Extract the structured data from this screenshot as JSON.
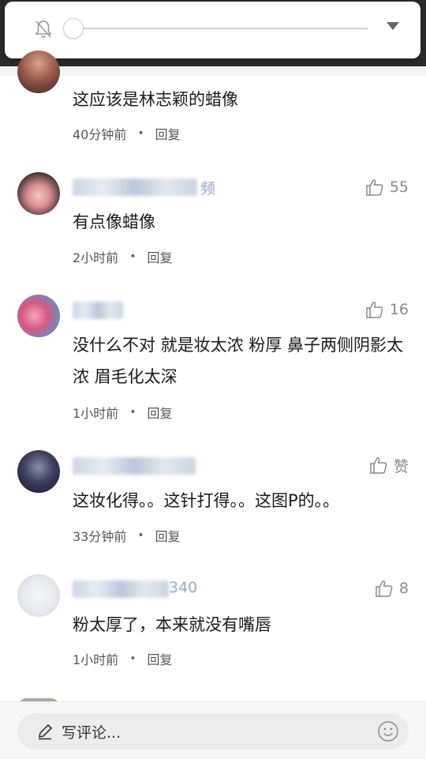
{
  "colors": {
    "accent_link": "#4a76b5",
    "text_primary": "#1a1a1a",
    "text_meta": "#555555"
  },
  "volume": {
    "level": 0.0
  },
  "comments": [
    {
      "username_tail": "",
      "text": "这应该是林志颖的蜡像",
      "time": "40分钟前",
      "reply": "回复",
      "likes": ""
    },
    {
      "username_tail": "频",
      "text": "有点像蜡像",
      "time": "2小时前",
      "reply": "回复",
      "likes": "55"
    },
    {
      "username_tail": "",
      "text": "没什么不对 就是妆太浓 粉厚 鼻子两侧阴影太浓 眉毛化太深",
      "time": "1小时前",
      "reply": "回复",
      "likes": "16"
    },
    {
      "username_tail": "",
      "text": "这妆化得。。这针打得。。这图P的。。",
      "time": "33分钟前",
      "reply": "回复",
      "likes": "赞"
    },
    {
      "username_tail": "340",
      "text": "粉太厚了，本来就没有嘴唇",
      "time": "1小时前",
      "reply": "回复",
      "likes": "8"
    }
  ],
  "footer": {
    "placeholder": "写评论..."
  }
}
